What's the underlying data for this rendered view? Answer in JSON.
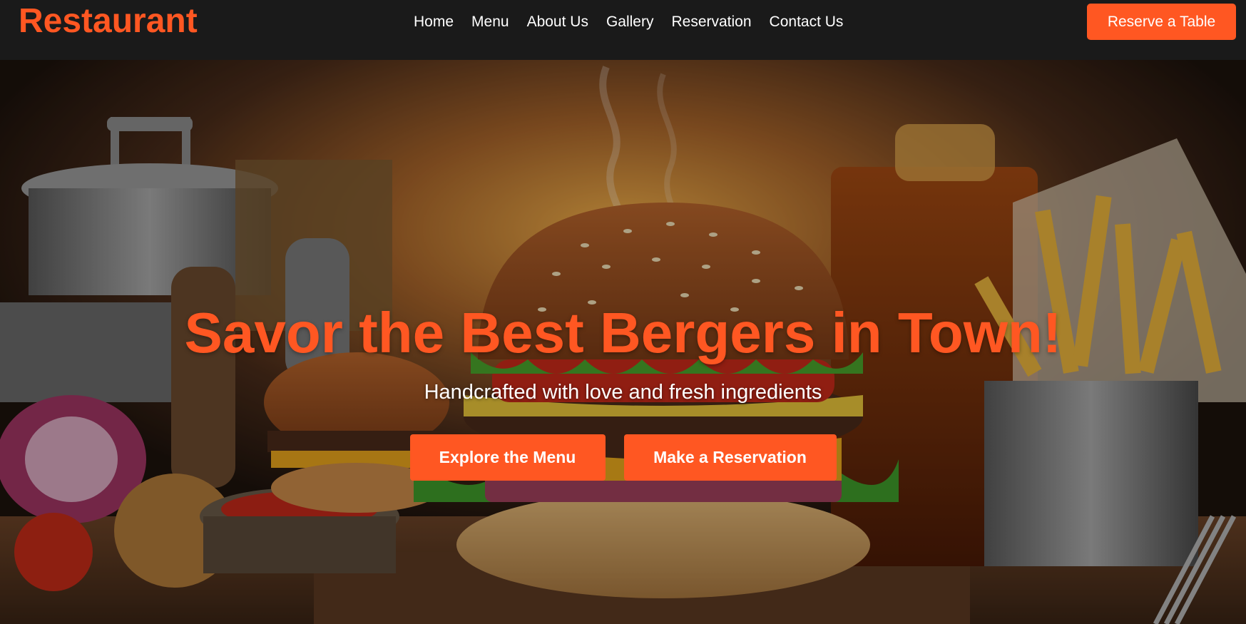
{
  "brand": {
    "name": "Restaurant",
    "accent_color": "#ff5722"
  },
  "nav": {
    "items": [
      {
        "label": "Home"
      },
      {
        "label": "Menu"
      },
      {
        "label": "About Us"
      },
      {
        "label": "Gallery"
      },
      {
        "label": "Reservation"
      },
      {
        "label": "Contact Us"
      }
    ],
    "cta_label": "Reserve a Table"
  },
  "hero": {
    "title": "Savor the Best Bergers in Town!",
    "subtitle": "Handcrafted with love and fresh ingredients",
    "primary_button": "Explore the Menu",
    "secondary_button": "Make a Reservation",
    "background_image": "burger-meal-photo"
  }
}
